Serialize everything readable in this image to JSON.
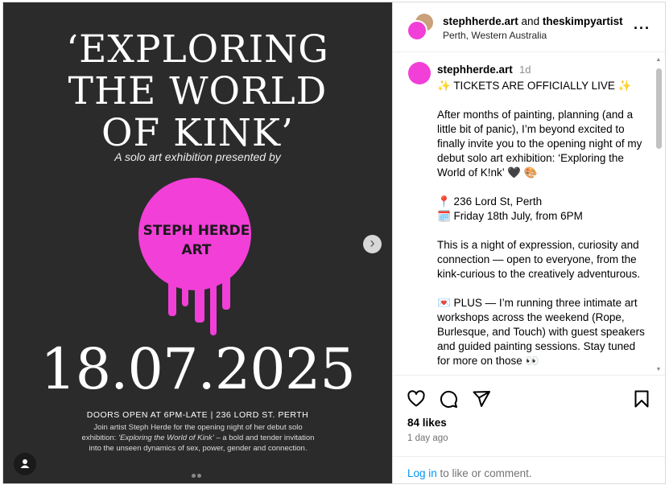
{
  "poster": {
    "title_lines": [
      "‘EXPLORING",
      "THE WORLD",
      "OF KINK’"
    ],
    "subtitle": "A solo art exhibition presented by",
    "brand_line1": "STEPH HERDE",
    "brand_line2": "ART",
    "date": "18.07.2025",
    "doors": "DOORS OPEN AT 6PM-LATE | 236 LORD ST. PERTH",
    "description_before": "Join artist Steph Herde for the opening night of her debut solo exhibition: ",
    "description_italic": "‘Exploring the World of Kink’",
    "description_after": " – a bold and tender invitation into the unseen dynamics of sex, power, gender and connection.",
    "carousel_position": 1,
    "carousel_total": 2
  },
  "header": {
    "user1": "stephherde.art",
    "conjunction": "and",
    "user2": "theskimpyartist",
    "location": "Perth, Western Australia",
    "more_icon": "more-horizontal-icon"
  },
  "caption": {
    "username": "stephherde.art",
    "time": "1d",
    "text": "✨ TICKETS ARE OFFICIALLY LIVE ✨\n\nAfter months of painting, planning (and a little bit of panic), I’m beyond excited to finally invite you to the opening night of my debut solo art exhibition: ‘Exploring the World of K!nk’ 🖤 🎨\n\n📍 236 Lord St, Perth\n🗓️ Friday 18th July, from 6PM\n\nThis is a night of expression, curiosity and connection — open to everyone, from the kink-curious to the creatively adventurous.\n\n💌 PLUS — I’m running three intimate art workshops across the weekend (Rope, Burlesque, and Touch) with guest speakers and guided painting sessions. Stay tuned for more on those 👀"
  },
  "actions": {
    "likes": "84 likes",
    "ago": "1 day ago",
    "login_link": "Log in",
    "login_rest": " to like or comment."
  },
  "colors": {
    "poster_bg": "#2b2b2b",
    "brand_pink": "#f23fd8",
    "link_blue": "#0095f6"
  }
}
